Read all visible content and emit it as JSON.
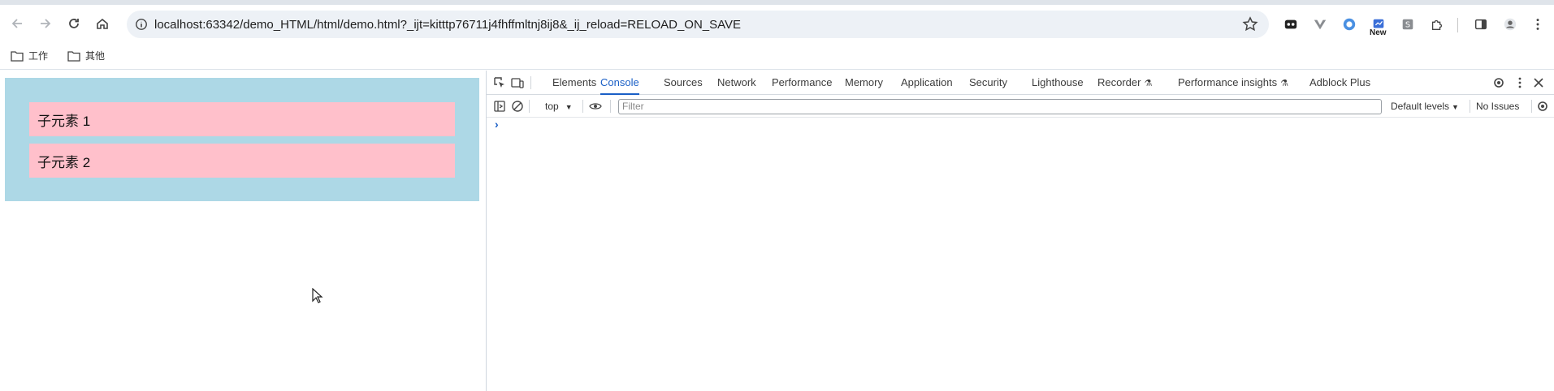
{
  "browser": {
    "url": "localhost:63342/demo_HTML/html/demo.html?_ijt=kitttp76711j4fhffmltnj8ij8&_ij_reload=RELOAD_ON_SAVE",
    "new_badge": "New"
  },
  "bookmarks": [
    {
      "label": "工作"
    },
    {
      "label": "其他"
    }
  ],
  "page": {
    "children": [
      "子元素 1",
      "子元素 2"
    ],
    "container_color": "#add8e6",
    "child_color": "#ffc0cb"
  },
  "devtools": {
    "tabs": [
      "Elements",
      "Console",
      "Sources",
      "Network",
      "Performance",
      "Memory",
      "Application",
      "Security",
      "Lighthouse",
      "Recorder",
      "Performance insights",
      "Adblock Plus"
    ],
    "active_tab": "Console",
    "context": "top",
    "filter_placeholder": "Filter",
    "levels": "Default levels",
    "issues": "No Issues",
    "prompt": "›",
    "accent": "#1a5fc6"
  }
}
